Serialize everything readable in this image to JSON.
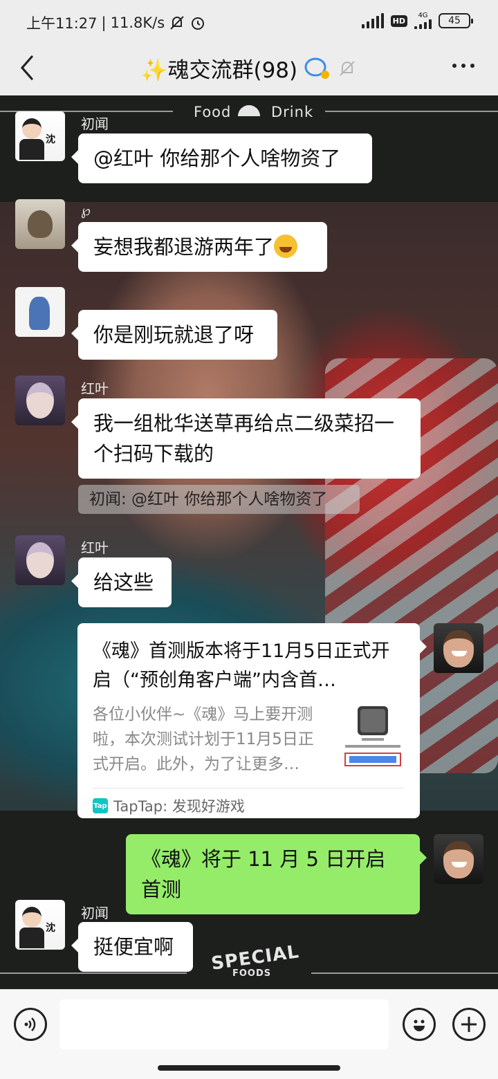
{
  "status_bar": {
    "time": "上午11:27",
    "net_speed": "11.8K/s",
    "hd": "HD",
    "network": "4G",
    "battery": "45"
  },
  "nav": {
    "title": "✨魂交流群(98)"
  },
  "decor": {
    "top_text": "Food",
    "top_text2": "Drink",
    "bottom_text": "SPECIAL",
    "bottom_sub": "FOODS"
  },
  "messages": [
    {
      "nick": "初闻",
      "text": "@红叶  你给那个人啥物资了"
    },
    {
      "nick": "℘",
      "text": "妄想我都退游两年了"
    },
    {
      "nick": "",
      "text": "你是刚玩就退了呀"
    },
    {
      "nick": "红叶",
      "text": "我一组枇华送草再给点二级菜招一个扫码下载的"
    },
    {
      "quote": "初闻: @红叶 你给那个人啥物资了"
    },
    {
      "nick": "红叶",
      "text": "给这些"
    },
    {
      "card": {
        "title": "《魂》首测版本将于11月5日正式开启（“预创角客户端”内含首…",
        "desc": "各位小伙伴~《魂》马上要开测啦，本次测试计划于11月5日正式开启。此外，为了让更多…",
        "source_icon": "Tap",
        "source": "TapTap: 发现好游戏"
      }
    },
    {
      "text": "《魂》将于 11 月 5 日开启首测"
    },
    {
      "nick": "初闻",
      "text": "挺便宜啊"
    }
  ],
  "avatar_text": {
    "chuwen": "沈"
  },
  "input": {
    "value": ""
  },
  "colors": {
    "bubble_self": "#95ec69",
    "bubble_other": "#ffffff",
    "chat_bg": "#1d1f1d"
  }
}
